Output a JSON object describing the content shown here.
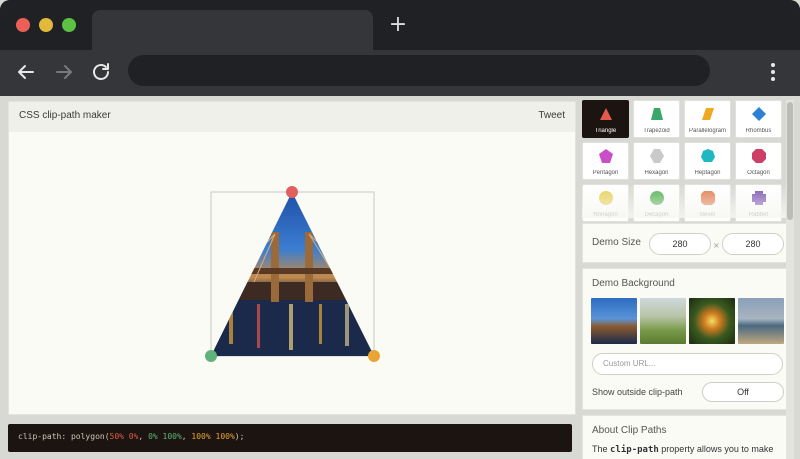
{
  "app": {
    "title": "CSS clip-path maker",
    "tweet_label": "Tweet"
  },
  "shapes": [
    {
      "label": "Triangle",
      "color": "#e15a4a",
      "active": true
    },
    {
      "label": "Trapezoid",
      "color": "#3aa86a",
      "active": false
    },
    {
      "label": "Parallelogram",
      "color": "#f0a820",
      "active": false
    },
    {
      "label": "Rhombus",
      "color": "#2e7fd6",
      "active": false
    },
    {
      "label": "Pentagon",
      "color": "#c94fc9",
      "active": false
    },
    {
      "label": "Hexagon",
      "color": "#c9c9c9",
      "active": false
    },
    {
      "label": "Heptagon",
      "color": "#1fb8c0",
      "active": false
    },
    {
      "label": "Octagon",
      "color": "#cc3f66",
      "active": false
    },
    {
      "label": "Nonagon",
      "color": "#e8cf52",
      "active": false
    },
    {
      "label": "Decagon",
      "color": "#4fb04f",
      "active": false
    },
    {
      "label": "Bevel",
      "color": "#e07a4a",
      "active": false
    },
    {
      "label": "Rabbet",
      "color": "#7a4fb0",
      "active": false
    }
  ],
  "demo_size": {
    "label": "Demo Size",
    "width": "280",
    "height": "280",
    "separator": "×"
  },
  "demo_background": {
    "label": "Demo Background",
    "url_placeholder": "Custom URL...",
    "show_outside_label": "Show outside clip-path",
    "show_outside_value": "Off"
  },
  "about": {
    "title": "About Clip Paths",
    "text_prefix": "The ",
    "code_term": "clip-path",
    "text_suffix": " property allows you to make complex shapes in CSS by clipping an element"
  },
  "code": {
    "prefix": "clip-path: polygon(",
    "p1": "50% 0%",
    "sep1": ", ",
    "p2": "0% 100%",
    "sep2": ", ",
    "p3": "100% 100%",
    "suffix": ");"
  },
  "colors": {
    "handle_top": "#e06060",
    "handle_left": "#5fb37a",
    "handle_right": "#e8a534"
  }
}
